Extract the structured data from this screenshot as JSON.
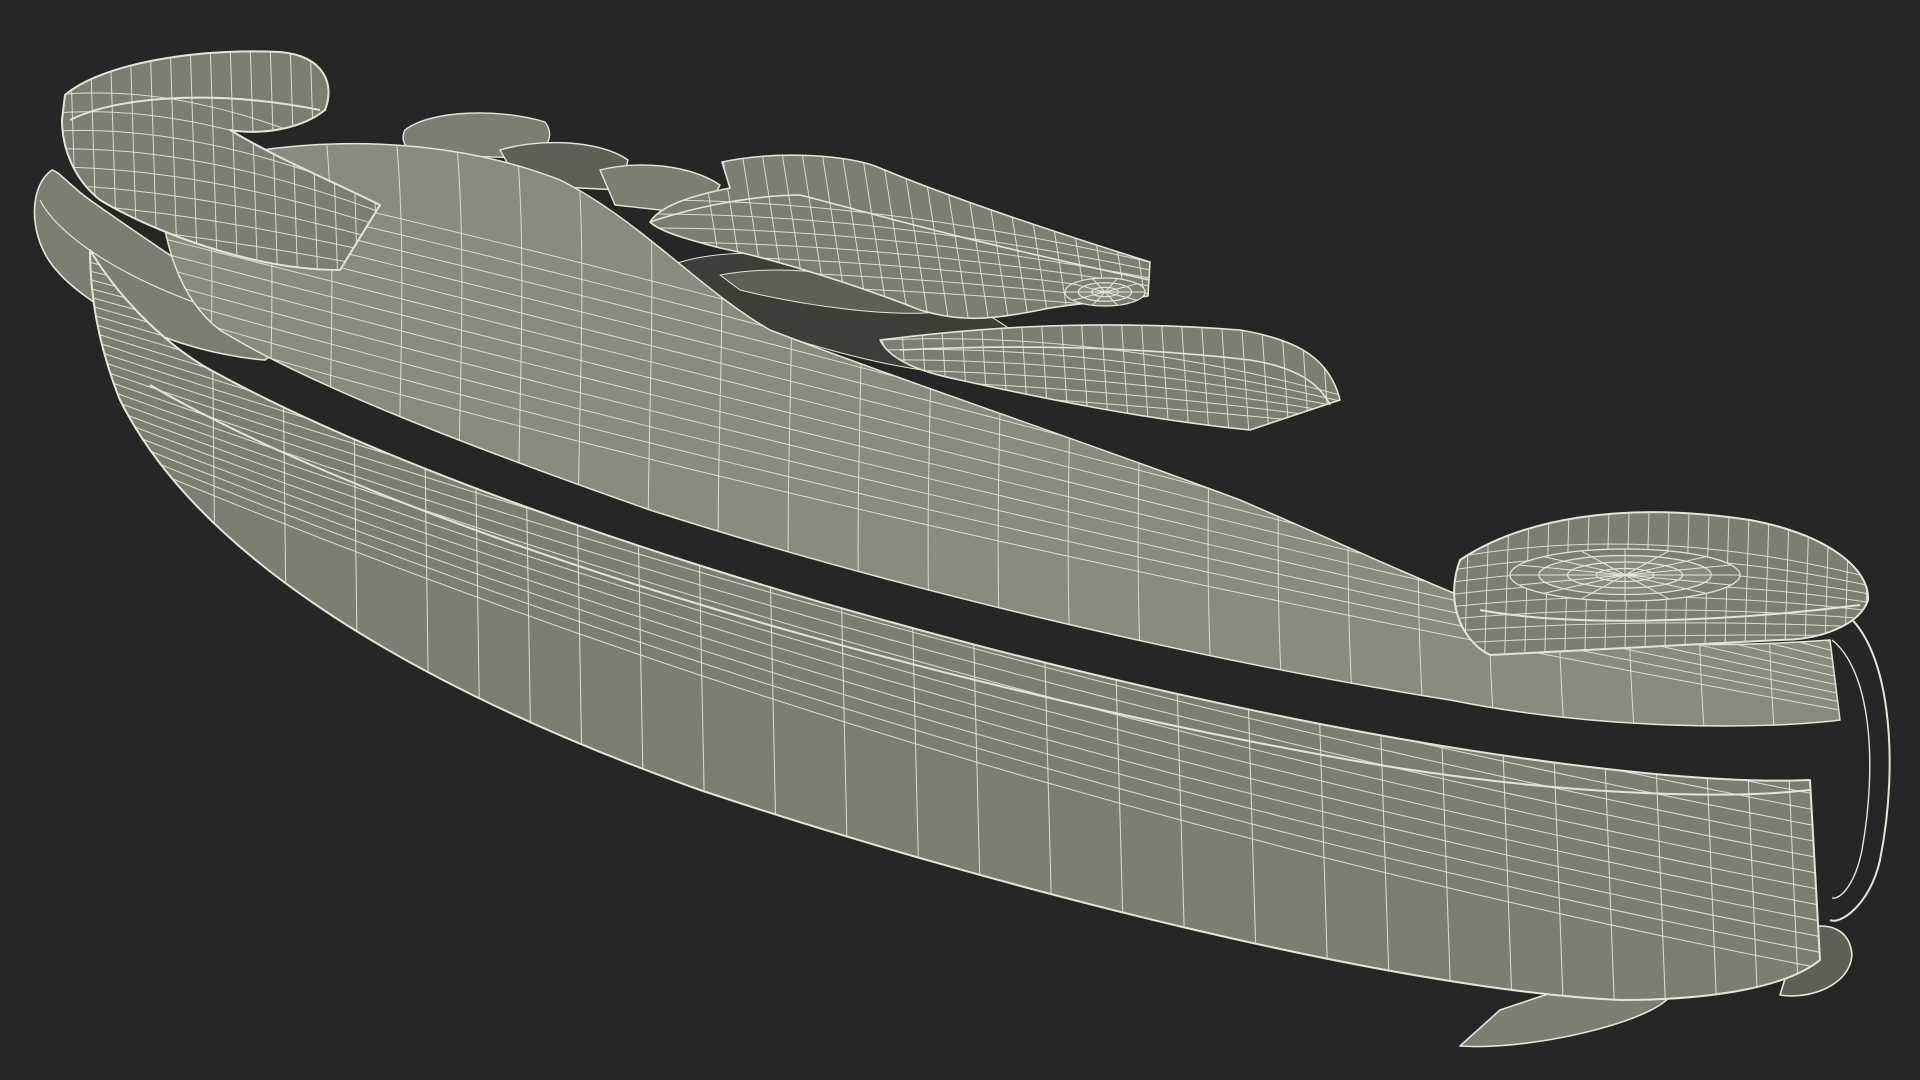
{
  "scene": {
    "subject": "wireframe-render",
    "colors": {
      "background": "#262626",
      "surface": "#7d7d72",
      "surface_shadow": "#5f5f56",
      "surface_dark": "#3e3e39",
      "highlight": "#8a8a7e",
      "wire": "#e4e4d6"
    }
  }
}
